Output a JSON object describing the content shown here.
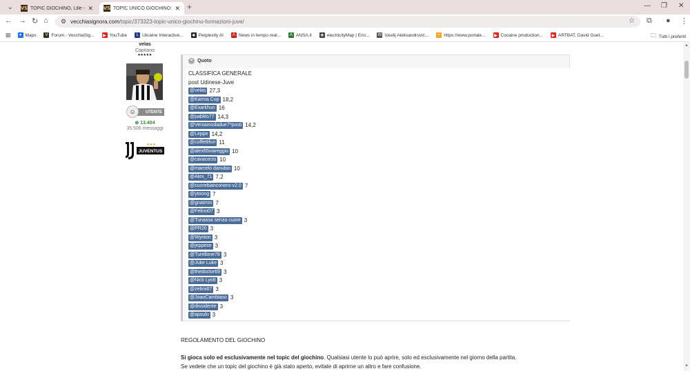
{
  "browser": {
    "tabs": [
      {
        "favicon": "VS",
        "title": "TOPIC GIOCHINO, Lille - Juventus"
      },
      {
        "favicon": "VS",
        "title": "TOPIC UNICO GIOCHINO: formazioni"
      }
    ],
    "url_host": "vecchiasignora.com",
    "url_path": "/topic/373323-topic-unico-giochino-formazioni-juve/",
    "bookmarks": [
      {
        "label": "Maps",
        "icon": "map-pin-icon",
        "color": "#1a73e8"
      },
      {
        "label": "Forum - VecchiaSig...",
        "icon": "vs-icon",
        "color": "#3a2d1c"
      },
      {
        "label": "YouTube",
        "icon": "youtube-icon",
        "color": "#e62117"
      },
      {
        "label": "Ukraine Interactive...",
        "icon": "lu-icon",
        "color": "#1e3a8a"
      },
      {
        "label": "Perplexity AI",
        "icon": "perplexity-icon",
        "color": "#222"
      },
      {
        "label": "News in tempo real...",
        "icon": "news-icon",
        "color": "#d81b1b"
      },
      {
        "label": "ANSA.it",
        "icon": "ansa-icon",
        "color": "#2e7d32"
      },
      {
        "label": "electricityMap | Emi...",
        "icon": "electricity-icon",
        "color": "#444"
      },
      {
        "label": "Vasilij Aleksandrović...",
        "icon": "wikipedia-icon",
        "color": "#555"
      },
      {
        "label": "https://www.portale...",
        "icon": "portale-icon",
        "color": "#f9a825"
      },
      {
        "label": "Cocaine production...",
        "icon": "youtube-icon",
        "color": "#e62117"
      },
      {
        "label": "ARTBAT, David Guet...",
        "icon": "youtube-icon",
        "color": "#e62117"
      }
    ],
    "all_bookmarks_label": "Tutti i preferiti"
  },
  "author": {
    "name": "velas",
    "rank": "Capitano",
    "badge_label": "UTENTE",
    "reputation": "13.404",
    "messages": "35.506 messaggi",
    "team_logo_text": "JUVENTUS"
  },
  "quote": {
    "header": "Quoto",
    "title": "CLASSIFICA GENERALE",
    "subtitle": "post Udinese-Juve",
    "rankings": [
      {
        "user": "@velas",
        "score": "27,3"
      },
      {
        "user": "@Karma Cop",
        "score": "18,2"
      },
      {
        "user": "@Exarkhun",
        "score": "16"
      },
      {
        "user": "@pablito77",
        "score": "14,3"
      },
      {
        "user": "@Veniamodadue7*posti",
        "score": "14,2"
      },
      {
        "user": "@Leppe",
        "score": "14,2"
      },
      {
        "user": "@coffettifun",
        "score": "11"
      },
      {
        "user": "@alex65viareggio",
        "score": "10"
      },
      {
        "user": "@cavacecio",
        "score": "10"
      },
      {
        "user": "@marcelo danubio",
        "score": "10"
      },
      {
        "user": "@Alex_71",
        "score": "7,2"
      },
      {
        "user": "@cuorebianconero-v2.0",
        "score": "7"
      },
      {
        "user": "@ytoong",
        "score": "7"
      },
      {
        "user": "@gnatmm",
        "score": "7"
      },
      {
        "user": "@Felino07",
        "score": "3"
      },
      {
        "user": "@Tunassa senza cuore",
        "score": "3"
      },
      {
        "user": "@PR20",
        "score": "3"
      },
      {
        "user": "@Wynton",
        "score": "3"
      },
      {
        "user": "@jeppese",
        "score": "3"
      },
      {
        "user": "@Turellone78",
        "score": "3"
      },
      {
        "user": "@Juke Luke",
        "score": "3"
      },
      {
        "user": "@thedoctor69",
        "score": "3"
      },
      {
        "user": "@Nick Lyott",
        "score": "3"
      },
      {
        "user": "@zebra67",
        "score": "3"
      },
      {
        "user": "@JoaoCambiaso",
        "score": "3"
      },
      {
        "user": "@dissidente",
        "score": "3"
      },
      {
        "user": "@apsulo",
        "score": "3"
      }
    ]
  },
  "rules": {
    "title": "REGOLAMENTO DEL GIOCHINO",
    "p1_bold": "Si gioca solo ed esclusivamente nel topic del giochino",
    "p1_rest": ". Qualsiasi utente lo può aprire, solo ed esclusivamente nel giorno della partita.",
    "p2": "Se vedete che un topic del giochino è già stato aperto, evitate di aprirne un altro e fare confusione."
  }
}
